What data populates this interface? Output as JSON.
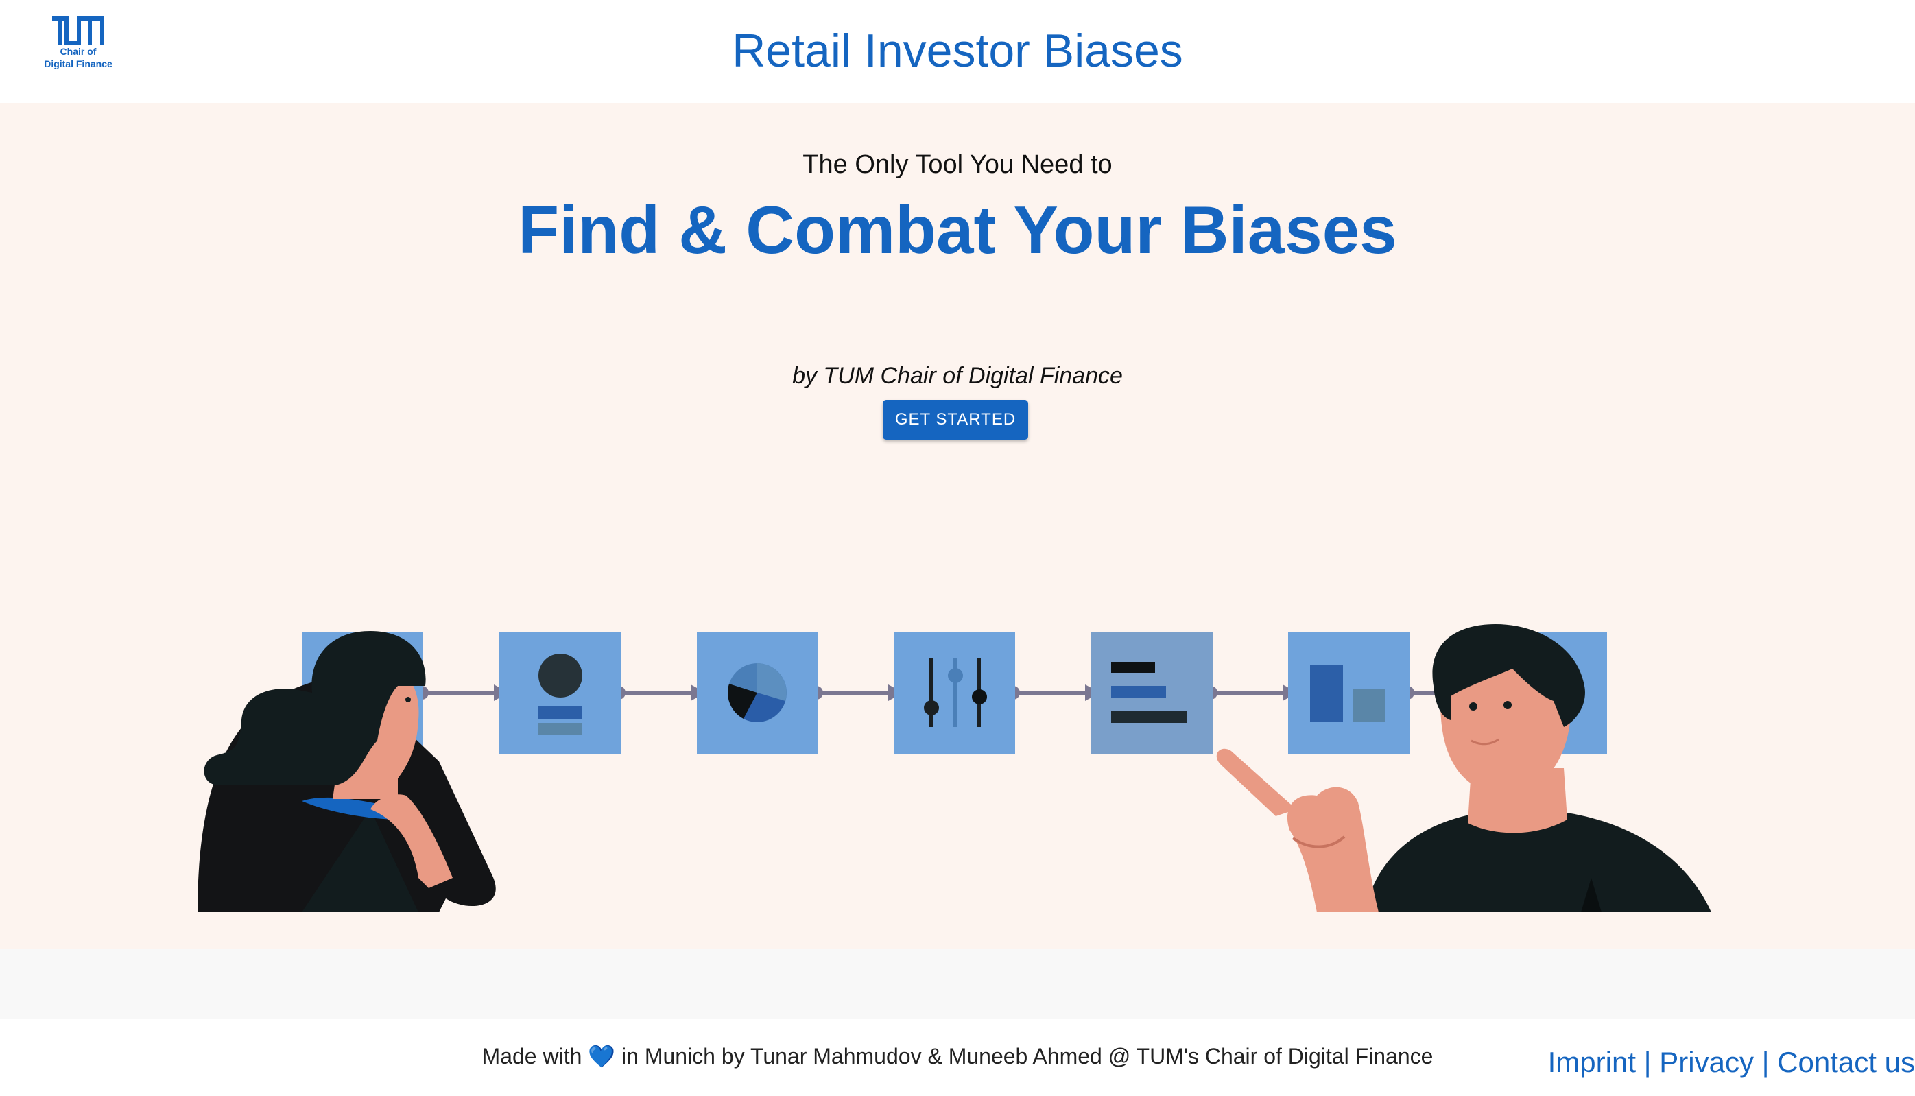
{
  "header": {
    "logo": {
      "wordmark": "TUM",
      "subtitle_line1": "Chair of",
      "subtitle_line2": "Digital Finance"
    },
    "title": "Retail Investor Biases"
  },
  "hero": {
    "tagline": "The Only Tool You Need to",
    "headline": "Find & Combat Your Biases",
    "byline": "by TUM Chair of Digital Finance",
    "cta_label": "GET STARTED"
  },
  "footer": {
    "credit_before": "Made with",
    "heart": "💙",
    "credit_after": "in Munich by Tunar Mahmudov & Muneeb Ahmed @ TUM's Chair of Digital Finance",
    "links": [
      "Imprint",
      "Privacy",
      "Contact us"
    ],
    "separator": "|"
  },
  "colors": {
    "brand": "#1565c0",
    "hero_bg": "#fdf4ef",
    "tile": "#6fa3dc",
    "connector": "#7b7791",
    "dark": "#12191a",
    "skin": "#e99a84"
  },
  "icons": [
    "avatar-card-icon",
    "pie-chart-icon",
    "sliders-icon",
    "bar-list-icon",
    "column-chart-icon",
    "list-icon"
  ]
}
